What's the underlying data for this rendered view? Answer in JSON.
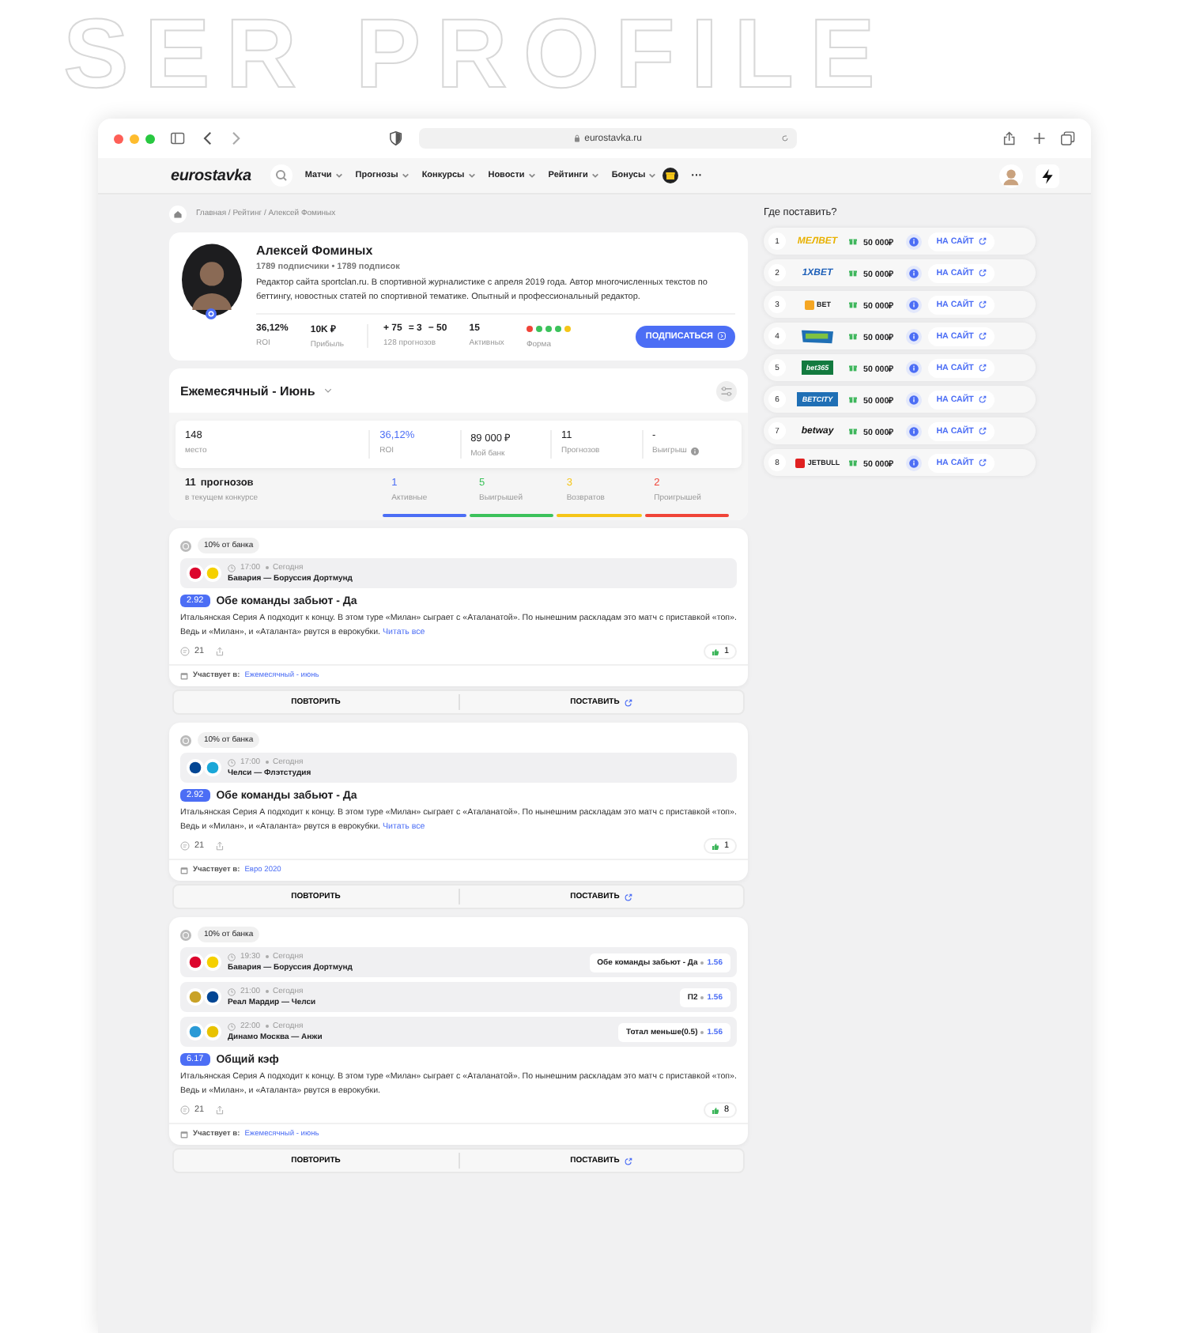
{
  "decor_title": "SER PROFILE",
  "browser": {
    "url": "eurostavka.ru"
  },
  "site": {
    "logo": "eurostavka",
    "nav": [
      "Матчи",
      "Прогнозы",
      "Конкурсы",
      "Новости",
      "Рейтинги",
      "Бонусы"
    ],
    "more": "···"
  },
  "breadcrumb": "Главная / Рейтинг / Алексей Фоминых",
  "profile": {
    "name": "Алексей Фоминых",
    "subs": "1789 подписчики  •  1789 подписок",
    "bio": "Редактор сайта sportclan.ru. В спортивной журналистике с апреля 2019 года. Автор многочисленных текстов по беттингу, новостных статей по спортивной тематике. Опытный и профессиональный редактор.",
    "stats": [
      {
        "value": "36,12%",
        "label": "ROI"
      },
      {
        "value": "10K ₽",
        "label": "Прибыль"
      }
    ],
    "record": {
      "won": "+ 75",
      "draw": "= 3",
      "lost": "− 50",
      "label": "128 прогнозов"
    },
    "active": {
      "value": "15",
      "label": "Активных"
    },
    "form": {
      "label": "Форма",
      "dots": [
        {
          "color": "#f04438"
        },
        {
          "color": "#3cc25b"
        },
        {
          "color": "#3cc25b"
        },
        {
          "color": "#3cc25b"
        },
        {
          "color": "#f5c518"
        }
      ]
    },
    "subscribe": "ПОДПИСАТЬСЯ"
  },
  "contest": {
    "title": "Ежемесячный - Июнь",
    "stats": [
      {
        "value": "148",
        "label": "место",
        "accent": false,
        "info": false
      },
      {
        "value": "36,12%",
        "label": "ROI",
        "accent": true,
        "info": false
      },
      {
        "value": "89 000 ₽",
        "label": "Мой банк",
        "accent": false,
        "info": false
      },
      {
        "value": "11",
        "label": "Прогнозов",
        "accent": false,
        "info": false
      },
      {
        "value": "-",
        "label": "Выигрыш",
        "accent": false,
        "info": true
      }
    ],
    "summary": {
      "count": "11",
      "unit": "прогнозов",
      "label": "в текущем конкурсе",
      "items": [
        {
          "value": "1",
          "label": "Активные",
          "color": "#4c6ef5"
        },
        {
          "value": "5",
          "label": "Выигрышей",
          "color": "#3cc25b"
        },
        {
          "value": "3",
          "label": "Возвратов",
          "color": "#f5c518"
        },
        {
          "value": "2",
          "label": "Проигрышей",
          "color": "#f04438"
        }
      ]
    }
  },
  "predictions": [
    {
      "stake": "10% от банка",
      "matches": [
        {
          "time": "17:00",
          "day": "Сегодня",
          "teams": "Бавария — Боруссия Дортмунд",
          "crests": [
            {
              "color": "#dc052d"
            },
            {
              "color": "#f5d000"
            }
          ]
        }
      ],
      "odds": "2.92",
      "title": "Обе команды забьют - Да",
      "text": "Итальянская Серия А подходит к концу. В этом туре «Милан» сыграет с «Аталанатой». По нынешним раскладам это матч с приставкой «топ». Ведь и «Милан», и «Аталанта» рвутся в еврокубки.",
      "read_more": "Читать все",
      "comments": "21",
      "likes": "1",
      "contest_label": "Участвует в:",
      "contest": "Ежемесячный - июнь",
      "repeat": "ПОВТОРИТЬ",
      "place": "ПОСТАВИТЬ"
    },
    {
      "stake": "10% от банка",
      "matches": [
        {
          "time": "17:00",
          "day": "Сегодня",
          "teams": "Челси — Флэтстудия",
          "crests": [
            {
              "color": "#034694"
            },
            {
              "color": "#1aa7d8"
            }
          ]
        }
      ],
      "odds": "2.92",
      "title": "Обе команды забьют - Да",
      "text": "Итальянская Серия А подходит к концу. В этом туре «Милан» сыграет с «Аталанатой». По нынешним раскладам это матч с приставкой «топ». Ведь и «Милан», и «Аталанта» рвутся в еврокубки.",
      "read_more": "Читать все",
      "comments": "21",
      "likes": "1",
      "contest_label": "Участвует в:",
      "contest": "Евро 2020",
      "repeat": "ПОВТОРИТЬ",
      "place": "ПОСТАВИТЬ"
    },
    {
      "stake": "10% от банка",
      "matches": [
        {
          "time": "19:30",
          "day": "Сегодня",
          "teams": "Бавария — Боруссия Дортмунд",
          "crests": [
            {
              "color": "#dc052d"
            },
            {
              "color": "#f5d000"
            }
          ],
          "bet": "Обе команды забьют - Да",
          "bet_odds": "1.56"
        },
        {
          "time": "21:00",
          "day": "Сегодня",
          "teams": "Реал Мардир — Челси",
          "crests": [
            {
              "color": "#c9a227"
            },
            {
              "color": "#034694"
            }
          ],
          "bet": "П2",
          "bet_odds": "1.56"
        },
        {
          "time": "22:00",
          "day": "Сегодня",
          "teams": "Динамо Москва  — Анжи",
          "crests": [
            {
              "color": "#2a9ad6"
            },
            {
              "color": "#e8c200"
            }
          ],
          "bet": "Тотал меньше(0.5)",
          "bet_odds": "1.56"
        }
      ],
      "odds": "6.17",
      "title": "Общий кэф",
      "text": "Итальянская Серия А подходит к концу. В этом туре «Милан» сыграет с «Аталанатой». По нынешним раскладам это матч с приставкой «топ». Ведь и «Милан», и «Аталанта» рвутся в еврокубки.",
      "comments": "21",
      "likes": "8",
      "contest_label": "Участвует в:",
      "contest": "Ежемесячный - июнь",
      "repeat": "ПОВТОРИТЬ",
      "place": "ПОСТАВИТЬ"
    }
  ],
  "sidebar": {
    "title": "Где поставить?",
    "bookmakers": [
      {
        "rank": "1",
        "logo": "МЕЛBET",
        "kind": "text",
        "color": "#e8b100",
        "bonus": "50 000₽",
        "action": "НА САЙТ"
      },
      {
        "rank": "2",
        "logo": "1XBET",
        "kind": "text",
        "color": "#1d5fb8",
        "bonus": "50 000₽",
        "action": "НА САЙТ"
      },
      {
        "rank": "3",
        "logo": "BET",
        "kind": "badge",
        "color": "#f5a623",
        "bonus": "50 000₽",
        "action": "НА САЙТ"
      },
      {
        "rank": "4",
        "kind": "flag",
        "color": "#1f6fb5",
        "bonus": "50 000₽",
        "action": "НА САЙТ"
      },
      {
        "rank": "5",
        "logo": "bet365",
        "kind": "tile",
        "color": "#137a3f",
        "bonus": "50 000₽",
        "action": "НА САЙТ"
      },
      {
        "rank": "6",
        "logo": "BETCITY",
        "kind": "tile",
        "color": "#1f6fb5",
        "bonus": "50 000₽",
        "action": "НА САЙТ"
      },
      {
        "rank": "7",
        "logo": "betway",
        "kind": "text",
        "color": "#111111",
        "bonus": "50 000₽",
        "action": "НА САЙТ"
      },
      {
        "rank": "8",
        "logo": "JETBULL",
        "kind": "badge",
        "color": "#e02020",
        "bonus": "50 000₽",
        "action": "НА САЙТ"
      }
    ]
  }
}
